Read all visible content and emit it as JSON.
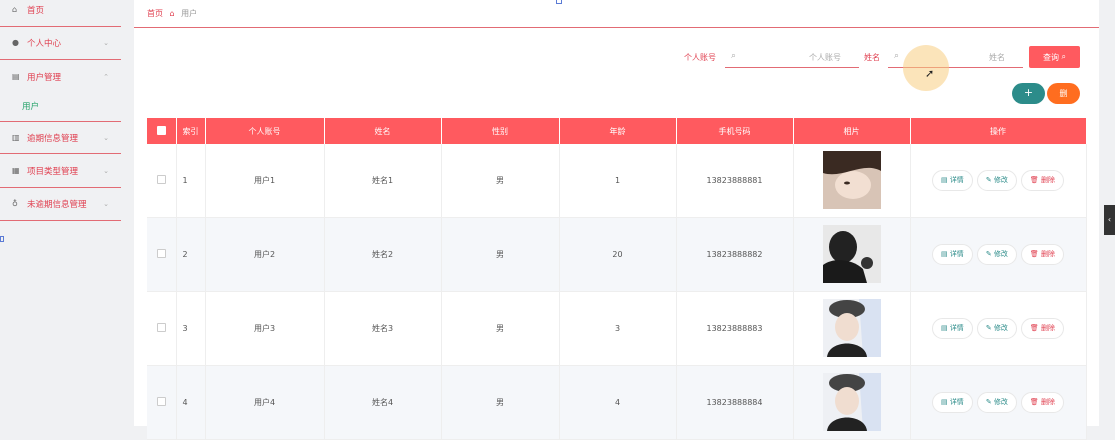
{
  "sidebar": {
    "items": [
      {
        "label": "首页",
        "icon": "home-icon"
      },
      {
        "label": "个人中心",
        "icon": "user-icon"
      },
      {
        "label": "用户管理",
        "icon": "users-icon"
      },
      {
        "label": "逾期信息管理",
        "icon": "chart-icon"
      },
      {
        "label": "项目类型管理",
        "icon": "grid-icon"
      },
      {
        "label": "未逾期信息管理",
        "icon": "bulb-icon"
      }
    ],
    "sub_item": "用户"
  },
  "breadcrumb": {
    "home": "首页",
    "current": "用户"
  },
  "search": {
    "account_label": "个人账号",
    "account_placeholder": "个人账号",
    "name_label": "姓名",
    "name_placeholder": "姓名",
    "query_button": "查询"
  },
  "actions": {
    "add": "+",
    "delete": "删"
  },
  "table": {
    "headers": [
      "索引",
      "个人账号",
      "姓名",
      "性别",
      "年龄",
      "手机号码",
      "相片",
      "操作"
    ],
    "rows": [
      {
        "index": "1",
        "account": "用户1",
        "name": "姓名1",
        "gender": "男",
        "age": "1",
        "phone": "13823888881"
      },
      {
        "index": "2",
        "account": "用户2",
        "name": "姓名2",
        "gender": "男",
        "age": "20",
        "phone": "13823888882"
      },
      {
        "index": "3",
        "account": "用户3",
        "name": "姓名3",
        "gender": "男",
        "age": "3",
        "phone": "13823888883"
      },
      {
        "index": "4",
        "account": "用户4",
        "name": "姓名4",
        "gender": "男",
        "age": "4",
        "phone": "13823888884"
      }
    ],
    "row_actions": {
      "detail": "详情",
      "edit": "修改",
      "delete": "删除"
    }
  },
  "colors": {
    "accent": "#ff5a5f",
    "teal": "#2c8c8a",
    "orange": "#ff6d1f"
  }
}
